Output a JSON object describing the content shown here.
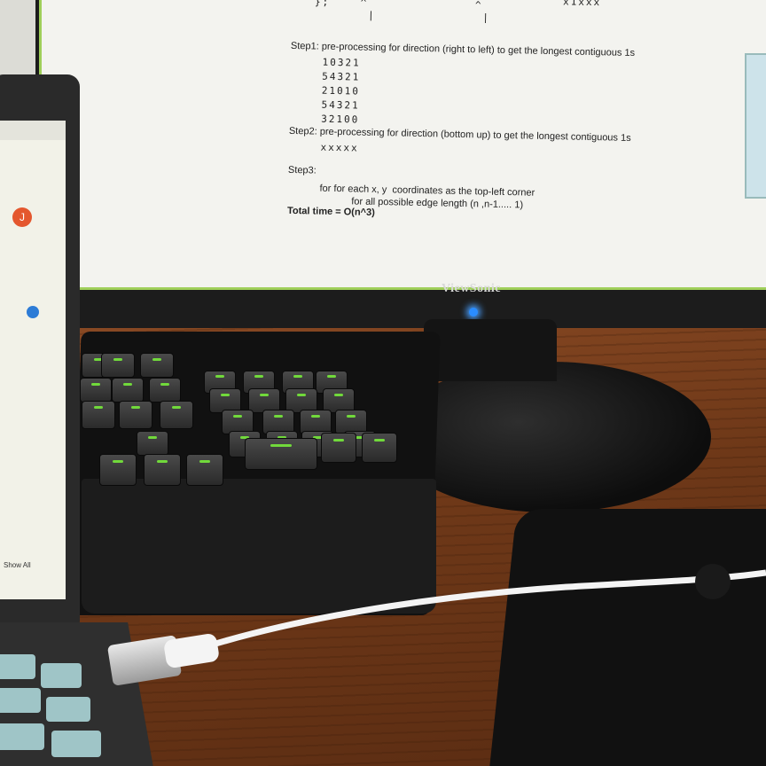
{
  "monitor": {
    "brand": "ViewSonic",
    "document_lines": [
      {
        "text": "};    ^              ^",
        "kind": "mono"
      },
      {
        "text": "       |              |",
        "kind": "mono"
      },
      {
        "text": "Step1: pre-processing for direction (right to left) to get the longest contiguous 1s",
        "kind": "plain"
      },
      {
        "text": "10321",
        "kind": "mono"
      },
      {
        "text": "54321",
        "kind": "mono"
      },
      {
        "text": "21010",
        "kind": "mono"
      },
      {
        "text": "54321",
        "kind": "mono"
      },
      {
        "text": "32100",
        "kind": "mono"
      },
      {
        "text": "Step2: pre-processing for direction (bottom up) to get the longest contiguous 1s",
        "kind": "plain"
      },
      {
        "text": "xxxxx",
        "kind": "mono"
      },
      {
        "text": "Step3:",
        "kind": "plain"
      },
      {
        "text": "for for each x, y  coordinates as the top-left corner",
        "kind": "plain"
      },
      {
        "text": "for all possible edge length (n ,n-1..... 1)",
        "kind": "plain"
      },
      {
        "text": "Total time = O(n^3)",
        "kind": "bold"
      }
    ],
    "top_right_fragment": "x1xxx",
    "power_led_color": "#2a8cff"
  },
  "laptop": {
    "avatar_letter": "J",
    "show_all_label": "Show All"
  },
  "colors": {
    "desk": "#6e3818",
    "key_backlight": "#7dff3a",
    "screen_border": "#9fcf5a"
  }
}
